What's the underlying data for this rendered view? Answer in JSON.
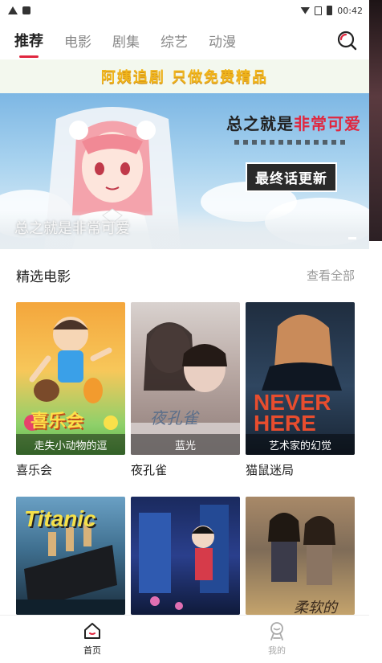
{
  "status_bar": {
    "time": "00:42"
  },
  "top_nav": {
    "tabs": [
      {
        "label": "推荐",
        "active": true
      },
      {
        "label": "电影",
        "active": false
      },
      {
        "label": "剧集",
        "active": false
      },
      {
        "label": "综艺",
        "active": false
      },
      {
        "label": "动漫",
        "active": false
      }
    ],
    "search_icon": "search-icon"
  },
  "banner": {
    "slogan": "阿姨追剧  只做免费精品",
    "headline_part1": "总之就是",
    "headline_part2": "非常可爱",
    "badge": "最终话更新",
    "caption": "总之就是非常可爱"
  },
  "section": {
    "title": "精选电影",
    "more": "查看全部"
  },
  "movies": [
    {
      "title": "喜乐会",
      "overlay": "走失小动物的逗",
      "poster_text": "喜乐会"
    },
    {
      "title": "夜孔雀",
      "overlay": "蓝光",
      "poster_text": "夜孔雀"
    },
    {
      "title": "猫鼠迷局",
      "overlay": "艺术家的幻觉",
      "poster_text": "NEVER HERE"
    },
    {
      "title": "",
      "overlay": "",
      "poster_text": "Titanic"
    },
    {
      "title": "",
      "overlay": "",
      "poster_text": ""
    },
    {
      "title": "",
      "overlay": "",
      "poster_text": "柔软的"
    }
  ],
  "bottom_bar": {
    "tabs": [
      {
        "label": "首页",
        "icon": "home-icon",
        "active": true
      },
      {
        "label": "我的",
        "icon": "profile-icon",
        "active": false
      }
    ]
  },
  "colors": {
    "accent": "#e0273f",
    "slogan": "#f0b51c"
  }
}
